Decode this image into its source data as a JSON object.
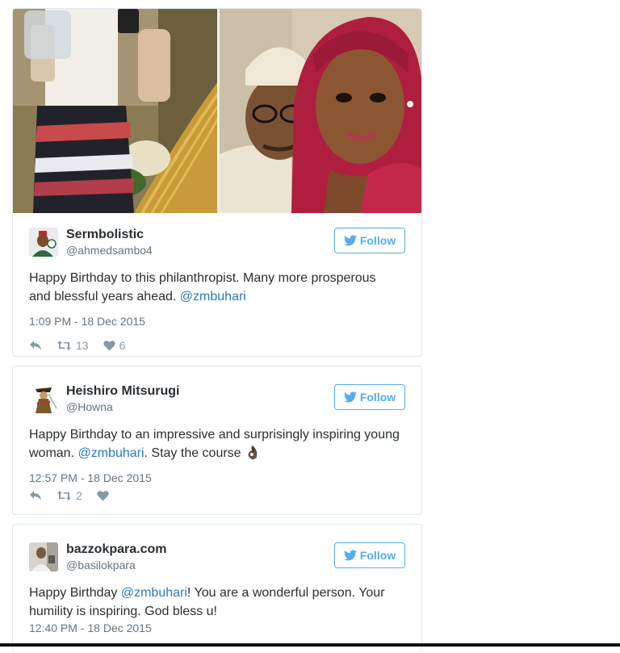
{
  "colors": {
    "accent": "#55acee",
    "link": "#2b7bb9",
    "muted": "#66757f",
    "border": "#e1e8ed"
  },
  "tweets": [
    {
      "name": "Sermbolistic",
      "handle": "@ahmedsambo4",
      "follow_label": "Follow",
      "text_before": "Happy Birthday to this philanthropist. Many more prosperous and blessful years ahead. ",
      "mention": "@zmbuhari",
      "text_after": "",
      "timestamp": "1:09 PM - 18 Dec 2015",
      "retweets": "13",
      "likes": "6"
    },
    {
      "name": "Heishiro Mitsurugi",
      "handle": "@Howna",
      "follow_label": "Follow",
      "text_before": "Happy Birthday to an impressive and surprisingly inspiring young woman. ",
      "mention": "@zmbuhari",
      "text_after": ". Stay the course ",
      "emoji": "👌🏿",
      "timestamp": "12:57 PM - 18 Dec 2015",
      "retweets": "2",
      "likes": ""
    },
    {
      "name": "bazzokpara.com",
      "handle": "@basilokpara",
      "follow_label": "Follow",
      "text_before": "Happy Birthday ",
      "mention": "@zmbuhari",
      "text_after": "! You are a wonderful person. Your humility is inspiring. God bless u!",
      "timestamp": "12:40 PM - 18 Dec 2015"
    }
  ]
}
